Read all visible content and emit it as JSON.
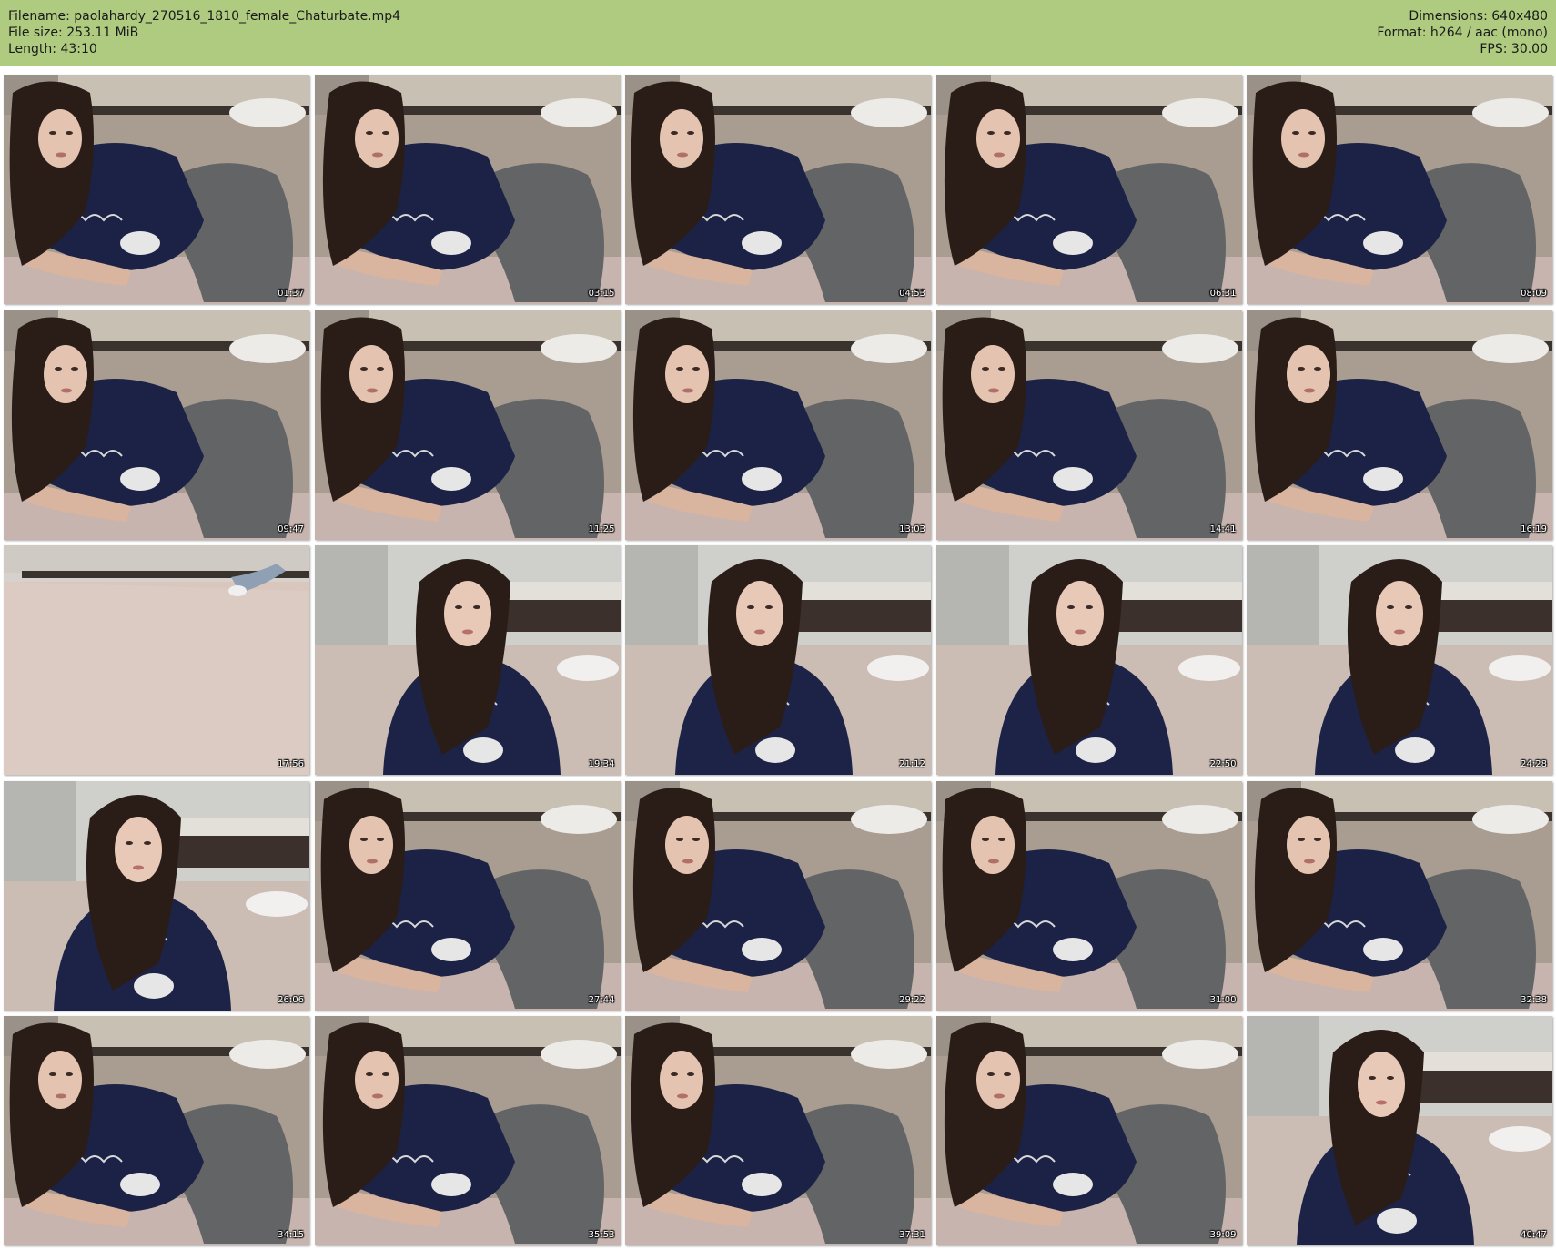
{
  "header": {
    "filename_line": "Filename: paolahardy_270516_1810_female_Chaturbate.mp4",
    "filesize_line": "File size: 253.11 MiB",
    "length_line": "Length: 43:10",
    "dimensions_line": "Dimensions: 640x480",
    "format_line": "Format: h264 / aac (mono)",
    "fps_line": "FPS: 30.00",
    "background_color": "#aecb80"
  },
  "frames": [
    {
      "timestamp": "01:37",
      "scene": "lying"
    },
    {
      "timestamp": "03:15",
      "scene": "lying"
    },
    {
      "timestamp": "04:53",
      "scene": "lying"
    },
    {
      "timestamp": "06:31",
      "scene": "lying"
    },
    {
      "timestamp": "08:09",
      "scene": "lying"
    },
    {
      "timestamp": "09:47",
      "scene": "lying"
    },
    {
      "timestamp": "11:25",
      "scene": "lying"
    },
    {
      "timestamp": "13:03",
      "scene": "lying"
    },
    {
      "timestamp": "14:41",
      "scene": "lying"
    },
    {
      "timestamp": "16:19",
      "scene": "lying"
    },
    {
      "timestamp": "17:56",
      "scene": "empty-bed"
    },
    {
      "timestamp": "19:34",
      "scene": "sitting"
    },
    {
      "timestamp": "21:12",
      "scene": "sitting"
    },
    {
      "timestamp": "22:50",
      "scene": "sitting"
    },
    {
      "timestamp": "24:28",
      "scene": "sitting"
    },
    {
      "timestamp": "26:06",
      "scene": "sitting"
    },
    {
      "timestamp": "27:44",
      "scene": "lying"
    },
    {
      "timestamp": "29:22",
      "scene": "lying"
    },
    {
      "timestamp": "31:00",
      "scene": "lying"
    },
    {
      "timestamp": "32:38",
      "scene": "lying"
    },
    {
      "timestamp": "34:15",
      "scene": "lying"
    },
    {
      "timestamp": "35:53",
      "scene": "lying"
    },
    {
      "timestamp": "37:31",
      "scene": "lying"
    },
    {
      "timestamp": "39:09",
      "scene": "lying"
    },
    {
      "timestamp": "40:47",
      "scene": "sitting"
    }
  ]
}
